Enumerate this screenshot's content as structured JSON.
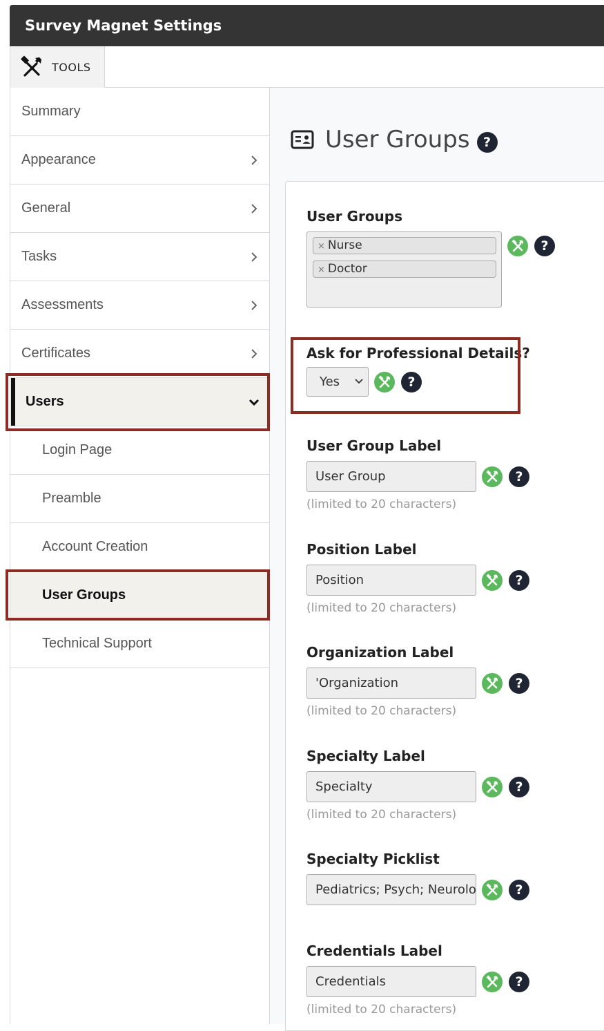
{
  "window": {
    "title": "Survey Magnet Settings"
  },
  "toolbar": {
    "tools_label": "TOOLS"
  },
  "sidebar": {
    "items": [
      {
        "label": "Summary"
      },
      {
        "label": "Appearance"
      },
      {
        "label": "General"
      },
      {
        "label": "Tasks"
      },
      {
        "label": "Assessments"
      },
      {
        "label": "Certificates"
      },
      {
        "label": "Users"
      }
    ],
    "subitems": [
      {
        "label": "Login Page"
      },
      {
        "label": "Preamble"
      },
      {
        "label": "Account Creation"
      },
      {
        "label": "User Groups"
      },
      {
        "label": "Technical Support"
      }
    ]
  },
  "page": {
    "title": "User Groups"
  },
  "form": {
    "user_groups": {
      "label": "User Groups",
      "tags": [
        "Nurse",
        "Doctor"
      ]
    },
    "professional_details": {
      "label": "Ask for Professional Details?",
      "value": "Yes"
    },
    "user_group_label": {
      "label": "User Group Label",
      "value": "User Group",
      "hint": "(limited to 20 characters)"
    },
    "position_label": {
      "label": "Position Label",
      "value": "Position",
      "hint": "(limited to 20 characters)"
    },
    "organization_label": {
      "label": "Organization Label",
      "value": "'Organization",
      "hint": "(limited to 20 characters)"
    },
    "specialty_label": {
      "label": "Specialty Label",
      "value": "Specialty",
      "hint": "(limited to 20 characters)"
    },
    "specialty_picklist": {
      "label": "Specialty Picklist",
      "value": "Pediatrics; Psych; Neurology"
    },
    "credentials_label": {
      "label": "Credentials Label",
      "value": "Credentials",
      "hint": "(limited to 20 characters)"
    }
  },
  "colors": {
    "highlight": "#8e2b22",
    "gear": "#5cb85c",
    "help": "#1f2532",
    "titlebar": "#343434"
  },
  "icons": {
    "tools": "tools-icon",
    "chevron": "chevron-right-icon",
    "expanded": "chevron-down-icon",
    "gear": "gear-icon",
    "help": "help-icon",
    "card": "id-card-icon"
  }
}
